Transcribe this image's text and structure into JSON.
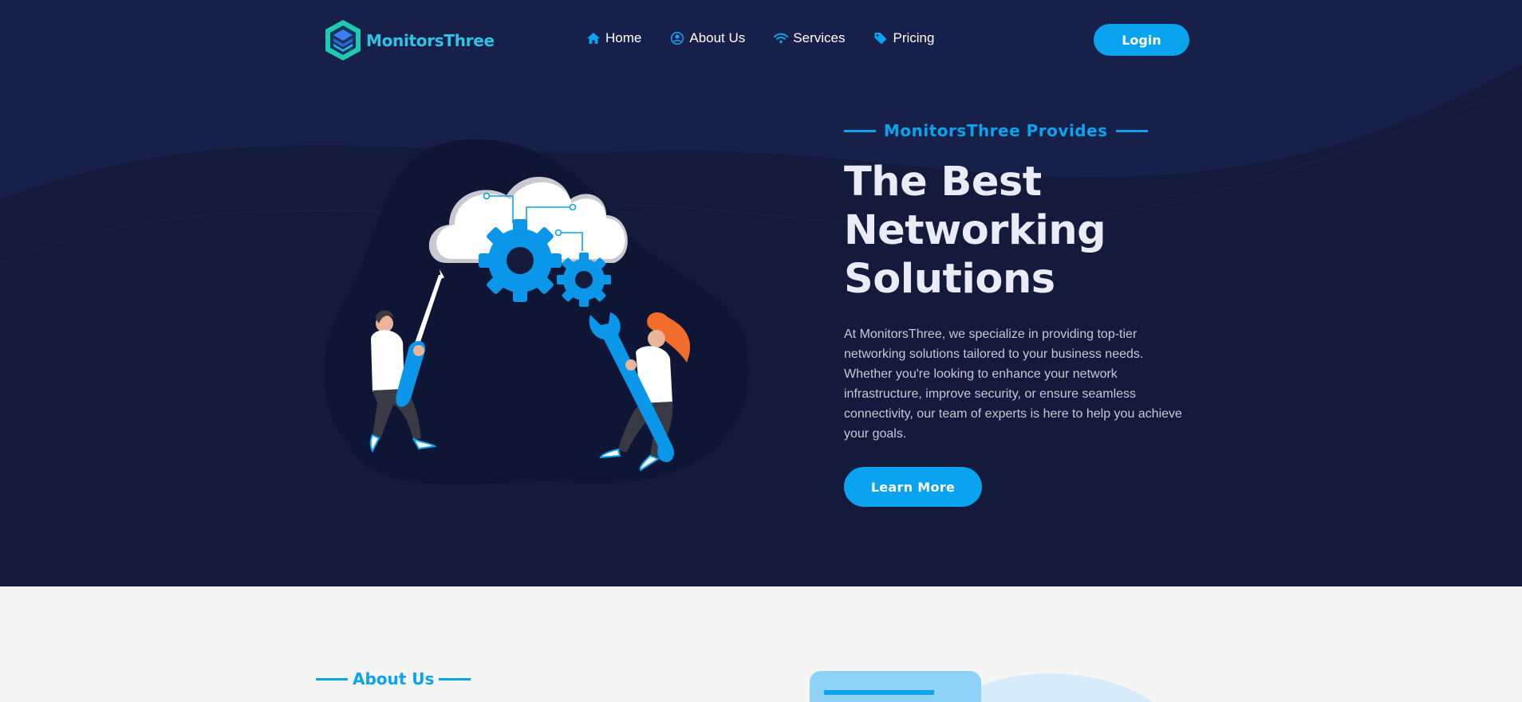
{
  "brand": {
    "name": "MonitorsThree"
  },
  "nav": {
    "items": [
      {
        "label": "Home",
        "icon": "home-icon"
      },
      {
        "label": "About Us",
        "icon": "user-circle-icon"
      },
      {
        "label": "Services",
        "icon": "wifi-icon"
      },
      {
        "label": "Pricing",
        "icon": "tag-icon"
      }
    ],
    "login_label": "Login"
  },
  "hero": {
    "eyebrow": "MonitorsThree Provides",
    "headline": "The Best Networking Solutions",
    "description": "At MonitorsThree, we specialize in providing top-tier networking solutions tailored to your business needs. Whether you're looking to enhance your network infrastructure, improve security, or ensure seamless connectivity, our team of experts is here to help you achieve your goals.",
    "cta_label": "Learn More",
    "illustration": "people-repairing-cloud-gears-illustration"
  },
  "about": {
    "label": "About Us"
  },
  "colors": {
    "accent": "#0aa3f0",
    "hero_bg": "#141a3c",
    "page_bg": "#f5f5f5",
    "logo_text": "#2fc3e8"
  }
}
